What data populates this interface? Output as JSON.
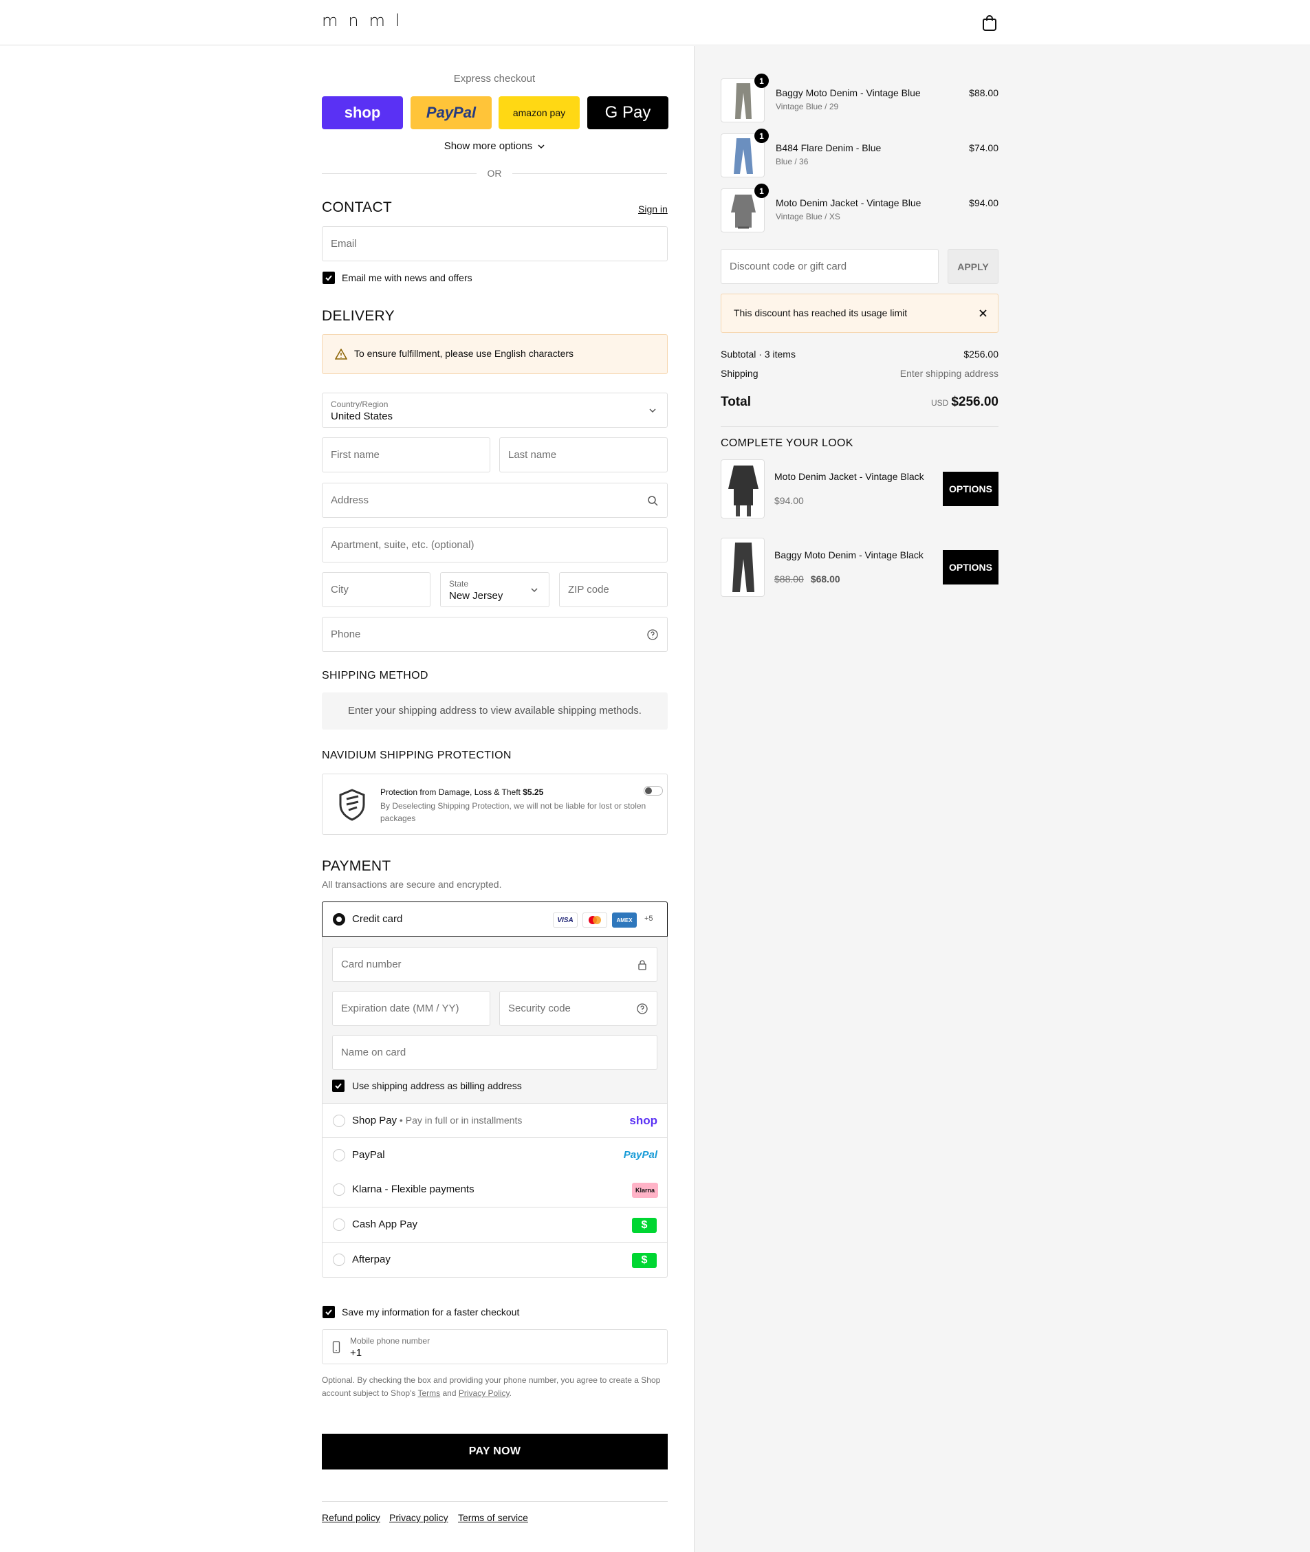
{
  "header": {
    "logo": "mnml",
    "cart_icon": "shopping-bag-icon"
  },
  "express": {
    "title": "Express checkout",
    "shop_label": "shop",
    "paypal_label": "PayPal",
    "amazon_label": "amazon pay",
    "gpay_label": "G Pay",
    "more_options": "Show more options",
    "or": "OR"
  },
  "contact": {
    "title": "CONTACT",
    "sign_in": "Sign in",
    "email_placeholder": "Email",
    "news_label": "Email me with news and offers"
  },
  "delivery": {
    "title": "DELIVERY",
    "warning": "To ensure fulfillment, please use English characters",
    "country_label": "Country/Region",
    "country_value": "United States",
    "first_name": "First name",
    "last_name": "Last name",
    "address": "Address",
    "apartment": "Apartment, suite, etc. (optional)",
    "city": "City",
    "state_label": "State",
    "state_value": "New Jersey",
    "zip": "ZIP code",
    "phone": "Phone"
  },
  "shipping_method": {
    "title": "SHIPPING METHOD",
    "info": "Enter your shipping address to view available shipping methods."
  },
  "protection": {
    "title": "NAVIDIUM SHIPPING PROTECTION",
    "headline": "Protection from Damage, Loss & Theft",
    "price": "$5.25",
    "note": "By Deselecting Shipping Protection, we will not be liable for lost or stolen packages"
  },
  "payment": {
    "title": "PAYMENT",
    "subtitle": "All transactions are secure and encrypted.",
    "credit_card": "Credit card",
    "more_cards": "+5",
    "card_number": "Card number",
    "expiration": "Expiration date (MM / YY)",
    "security_code": "Security code",
    "name_on_card": "Name on card",
    "billing_same": "Use shipping address as billing address",
    "options": [
      {
        "label": "Shop Pay",
        "sub": "Pay in full or in installments",
        "badge": "shop"
      },
      {
        "label": "PayPal",
        "sub": "",
        "badge": "PayPal"
      },
      {
        "label": "Klarna - Flexible payments",
        "sub": "",
        "badge": "Klarna"
      },
      {
        "label": "Cash App Pay",
        "sub": "",
        "badge": "$"
      },
      {
        "label": "Afterpay",
        "sub": "",
        "badge": "$"
      }
    ]
  },
  "remember": {
    "label": "Save my information for a faster checkout",
    "phone_label": "Mobile phone number",
    "phone_value": "+1",
    "legal_1": "Optional. By checking the box and providing your phone number, you agree to create a Shop account subject to Shop's ",
    "terms": "Terms",
    "and": " and ",
    "privacy": "Privacy Policy",
    "period": "."
  },
  "pay_now": "PAY NOW",
  "footer": {
    "refund": "Refund policy",
    "privacy": "Privacy policy",
    "terms": "Terms of service"
  },
  "cart": {
    "items": [
      {
        "name": "Baggy Moto Denim - Vintage Blue",
        "variant": "Vintage Blue / 29",
        "price": "$88.00",
        "qty": "1"
      },
      {
        "name": "B484 Flare Denim - Blue",
        "variant": "Blue / 36",
        "price": "$74.00",
        "qty": "1"
      },
      {
        "name": "Moto Denim Jacket - Vintage Blue",
        "variant": "Vintage Blue / XS",
        "price": "$94.00",
        "qty": "1"
      }
    ],
    "discount_placeholder": "Discount code or gift card",
    "apply": "APPLY",
    "discount_error": "This discount has reached its usage limit",
    "subtotal_label": "Subtotal · 3 items",
    "subtotal_value": "$256.00",
    "shipping_label": "Shipping",
    "shipping_value": "Enter shipping address",
    "total_label": "Total",
    "currency": "USD",
    "total_value": "$256.00"
  },
  "upsell": {
    "title": "COMPLETE YOUR LOOK",
    "items": [
      {
        "name": "Moto Denim Jacket - Vintage Black",
        "price": "$94.00",
        "compare": "",
        "button": "OPTIONS"
      },
      {
        "name": "Baggy Moto Denim - Vintage Black",
        "price": "$68.00",
        "compare": "$88.00",
        "button": "OPTIONS"
      }
    ]
  },
  "colors": {
    "shop_purple": "#5a31f4",
    "paypal_yellow": "#ffc439",
    "amazon_yellow": "#ffd814",
    "cashapp_green": "#00d632",
    "klarna_pink": "#ffb3c7",
    "warning_bg": "#fef5ea"
  }
}
